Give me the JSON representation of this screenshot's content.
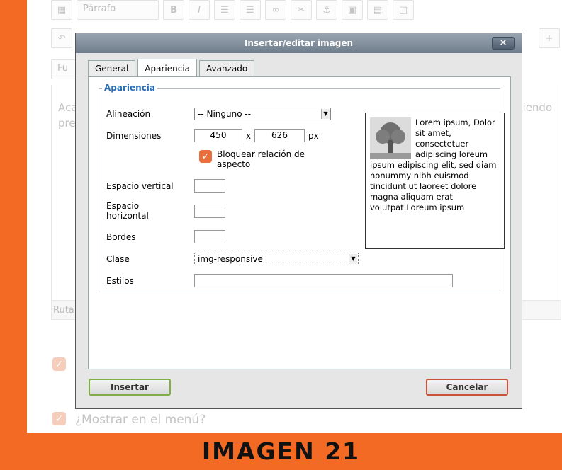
{
  "background": {
    "format_select": "Párrafo",
    "font_select": "Fu",
    "editor_text_line1": "Aca",
    "editor_text_line2": "pre",
    "editor_text_right": "piendo",
    "path_label": "Ruta",
    "show_in_menu_label": "¿Mostrar en el menú?"
  },
  "dialog": {
    "title": "Insertar/editar imagen",
    "close_symbol": "✕",
    "tabs": [
      {
        "label": "General",
        "active": false
      },
      {
        "label": "Apariencia",
        "active": true
      },
      {
        "label": "Avanzado",
        "active": false
      }
    ],
    "fieldset_legend": "Apariencia",
    "fields": {
      "alignment_label": "Alineación",
      "alignment_value": "-- Ninguno --",
      "dimensions_label": "Dimensiones",
      "width_value": "450",
      "height_value": "626",
      "dim_separator": "x",
      "dim_unit": "px",
      "lock_ratio_label_line1": "Bloquear relación de",
      "lock_ratio_label_line2": "aspecto",
      "lock_ratio_checked": true,
      "vspace_label": "Espacio vertical",
      "vspace_value": "",
      "hspace_label_line1": "Espacio",
      "hspace_label_line2": "horizontal",
      "hspace_value": "",
      "border_label": "Bordes",
      "border_value": "",
      "class_label": "Clase",
      "class_value": "img-responsive",
      "styles_label": "Estilos",
      "styles_value": ""
    },
    "preview_text": "Lorem ipsum, Dolor sit amet, consectetuer adipiscing loreum ipsum edipiscing elit, sed diam nonummy nibh euismod tincidunt ut laoreet dolore magna aliquam erat volutpat.Loreum ipsum",
    "insert_button": "Insertar",
    "cancel_button": "Cancelar"
  },
  "caption": "IMAGEN 21",
  "colors": {
    "accent_orange": "#f26a23",
    "legend_blue": "#2b6db5",
    "insert_border": "#7fae42",
    "cancel_border": "#c9523a"
  }
}
